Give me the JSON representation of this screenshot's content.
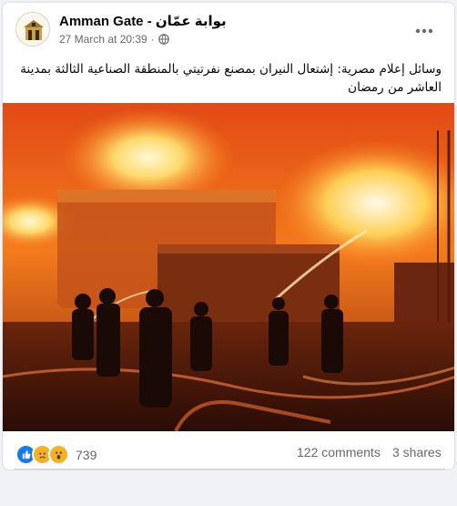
{
  "post": {
    "page_name": "Amman Gate - بوابة عمّان",
    "timestamp": "27 March at 20:39",
    "separator": "·",
    "audience_icon": "globe-icon",
    "more_icon": "ellipsis-icon",
    "caption": "وسائل إعلام مصرية: إشتعال النيران بمصنع نفرتيتي بالمنطقة الصناعية الثالثة بمدينة العاشر من رمضان",
    "photo_description_icon": "factory-fire-photo"
  },
  "engagement": {
    "reaction_icons": [
      "like-icon",
      "sad-icon",
      "wow-icon"
    ],
    "reaction_count": "739",
    "comments": "122 comments",
    "shares": "3 shares"
  },
  "colors": {
    "like_blue": "#1877f2",
    "reaction_yellow": "#f7b125",
    "text_secondary": "#65676b",
    "text_primary": "#050505"
  }
}
